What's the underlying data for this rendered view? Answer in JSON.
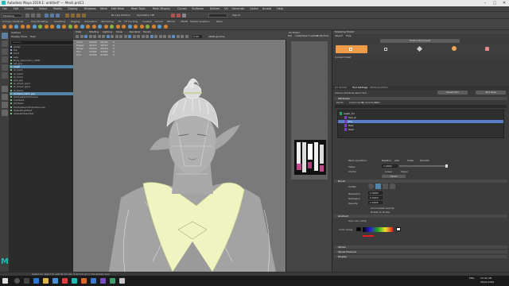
{
  "window": {
    "title": "Autodesk Maya 2019.1: untitled* --- Mesh.pnt11"
  },
  "menubar": {
    "items": [
      "File",
      "Edit",
      "Create",
      "Select",
      "Modify",
      "Display",
      "Windows",
      "Mesh",
      "Edit Mesh",
      "Mesh Tools",
      "Mesh Display",
      "Curves",
      "Surfaces",
      "Deform",
      "UV",
      "Generate",
      "Cache",
      "Arnold",
      "Help"
    ]
  },
  "toolbar": {
    "mode_select": "Modeling",
    "live_surface": "No Live Surface",
    "symmetry": "Symmetry: Off",
    "sign_in": "Sign In"
  },
  "shelf": {
    "tabs": [
      "Curves / Surfaces",
      "Poly Modeling",
      "Sculpting",
      "Rigging",
      "Animation",
      "Rendering",
      "FX",
      "FX Caching",
      "Custom",
      "Arnold",
      "Bifrost",
      "MASH",
      "Motion Graphics",
      "XGen"
    ]
  },
  "outliner": {
    "title": "Outliner",
    "menu": [
      "Display",
      "Show",
      "Help"
    ],
    "search_placeholder": "Search...",
    "items": [
      {
        "label": "persp",
        "selected": false
      },
      {
        "label": "top",
        "selected": false
      },
      {
        "label": "front",
        "selected": false
      },
      {
        "label": "side",
        "selected": false
      },
      {
        "label": "Body_Geometry_CPAR",
        "selected": false
      },
      {
        "label": "ref_grp",
        "selected": false
      },
      {
        "label": "mesh",
        "selected": true
      },
      {
        "label": "ik_hair1",
        "selected": false
      },
      {
        "label": "ik_hair2",
        "selected": false
      },
      {
        "label": "ik_hair3",
        "selected": false
      },
      {
        "label": "eye_grp",
        "selected": false
      },
      {
        "label": "ik_direct_grp1",
        "selected": false
      },
      {
        "label": "ik_direct_grp2",
        "selected": false
      },
      {
        "label": "ik_hair4",
        "selected": false
      },
      {
        "label": "hairGeo_Card_grp",
        "selected": true
      },
      {
        "label": "hairSystem1Follicles",
        "selected": false
      },
      {
        "label": "nucleus1",
        "selected": false
      },
      {
        "label": "pfxHair1",
        "selected": false
      },
      {
        "label": "hairSystem1OutputCurves",
        "selected": false
      },
      {
        "label": "defaultLightSet",
        "selected": false
      },
      {
        "label": "defaultObjectSet",
        "selected": false
      }
    ]
  },
  "viewport": {
    "menu": [
      "View",
      "Shading",
      "Lighting",
      "Show",
      "Renderer",
      "Panels"
    ],
    "stats": [
      {
        "label": "Verts:",
        "a": "26434",
        "b": "26434",
        "c": "0"
      },
      {
        "label": "Edges:",
        "a": "49715",
        "b": "49715",
        "c": "0"
      },
      {
        "label": "Faces:",
        "a": "24310",
        "b": "24310",
        "c": "0"
      },
      {
        "label": "Tris:",
        "a": "47664",
        "b": "47664",
        "c": "0"
      },
      {
        "label": "UVs:",
        "a": "32426",
        "b": "32426",
        "c": "0"
      }
    ],
    "camera_field": "0.00",
    "gamma": "sRGB gamma"
  },
  "uv_editor": {
    "title": "UV Editor",
    "menu": [
      "Edit",
      "Create",
      "Select",
      "Cut/Sew",
      "Modify",
      "Tools"
    ]
  },
  "right_panel": {
    "title": "Modeling Toolkit",
    "menu": [
      "Object",
      "Help"
    ],
    "section_button": "Multi-Component",
    "subtitle": "Context Shelf",
    "tabs": [
      "UV Toolkit",
      "Tool Settings",
      "Attribute Editor"
    ],
    "tool_name": "Artisan Attribute Paint Tool",
    "reset_label": "Reset Tool",
    "help_label": "Tool Help",
    "section_attributes": "Attributes",
    "attr_tabs": [
      "Points",
      "Components",
      "By Selected Geo",
      "All"
    ],
    "paint_list": [
      {
        "label": "mesh_fur",
        "level": 0,
        "selected": false
      },
      {
        "label": "hair_ik",
        "level": 1,
        "selected": false
      },
      {
        "label": "fire",
        "level": 1,
        "selected": true
      },
      {
        "label": "fire1",
        "level": 1,
        "selected": false
      },
      {
        "label": "fire2",
        "level": 1,
        "selected": false
      }
    ],
    "operation_label": "Paint operation:",
    "operation_options": [
      "Replace",
      "Add",
      "Scale",
      "Smooth"
    ],
    "value_label": "Value:",
    "value": "1.0000",
    "clamp_label": "Clamp:",
    "clamp_lower": "Lower",
    "clamp_upper": "Upper",
    "flood_label": "Flood",
    "brush_label": "Brush",
    "profile_label": "Profile:",
    "radius_u_label": "Radius(U):",
    "radius_u": "1.0000",
    "radius_l_label": "Radius(L):",
    "radius_l": "0.0010",
    "opacity_label": "Opacity:",
    "opacity": "1.0000",
    "accumulate_label": "Accumulate opacity",
    "rotate_label": "Rotate to stroke",
    "gradient_section": "Gradient",
    "use_ramp_label": "Use color ramp",
    "color_ramp_label": "Color ramp:",
    "collapsed_sections": [
      "Stroke",
      "Stylus Pressure",
      "Display"
    ]
  },
  "status_bar": {
    "text": "Select an object to edit its UV set, it should go to the artisan tool"
  },
  "taskbar": {
    "time": "10:42 AM",
    "date": "28/01/2020",
    "language": "ENG"
  },
  "colors": {
    "accent": "#5285a6",
    "selection_list": "#5a7fc9",
    "maya_logo": "#1fbbb6"
  }
}
